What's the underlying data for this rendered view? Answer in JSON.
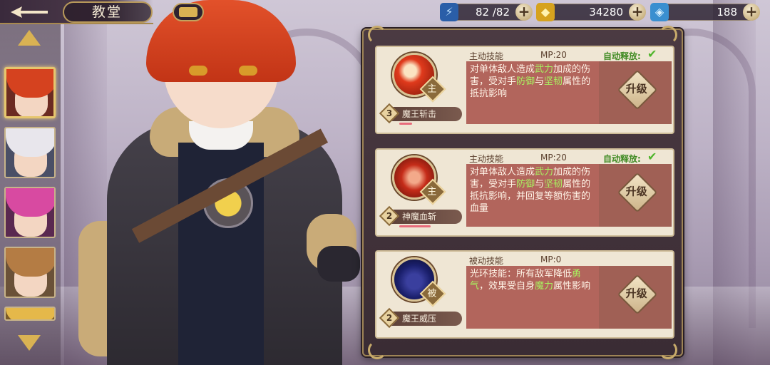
{
  "header": {
    "back_icon": "back-arrow-icon",
    "title": "教堂",
    "scroll_icon": "scroll-icon"
  },
  "resources": {
    "stamina": {
      "icon": "lightning-icon",
      "value": "82 /82"
    },
    "gold": {
      "icon": "gold-coin-icon",
      "value": "34280"
    },
    "gem": {
      "icon": "gem-card-icon",
      "value": "188"
    },
    "plus": "+"
  },
  "heroes": [
    {
      "name": "hero-red-hair",
      "selected": true
    },
    {
      "name": "hero-white-hair",
      "selected": false
    },
    {
      "name": "hero-pink-hair",
      "selected": false
    },
    {
      "name": "hero-brown-hair-glasses",
      "selected": false
    },
    {
      "name": "hero-blonde",
      "selected": false
    }
  ],
  "skills": [
    {
      "type_label": "主动技能",
      "mp_label": "MP:20",
      "auto_label": "自动释放:",
      "auto_check": "✔",
      "badge": "主",
      "level": "3",
      "name": "魔王斩击",
      "progress": 0.2,
      "desc_parts": [
        {
          "text": "对单体敌人造成",
          "hl": false
        },
        {
          "text": "武力",
          "hl": true
        },
        {
          "text": "加成的伤害，受对手",
          "hl": false
        },
        {
          "text": "防御",
          "hl": true
        },
        {
          "text": "与",
          "hl": false
        },
        {
          "text": "坚韧",
          "hl": true
        },
        {
          "text": "属性的抵抗影响",
          "hl": false
        }
      ],
      "upgrade_label": "升级"
    },
    {
      "type_label": "主动技能",
      "mp_label": "MP:20",
      "auto_label": "自动释放:",
      "auto_check": "✔",
      "badge": "主",
      "level": "2",
      "name": "神魔血斩",
      "progress": 0.5,
      "desc_parts": [
        {
          "text": "对单体敌人造成",
          "hl": false
        },
        {
          "text": "武力",
          "hl": true
        },
        {
          "text": "加成的伤害，受对手",
          "hl": false
        },
        {
          "text": "防御",
          "hl": true
        },
        {
          "text": "与",
          "hl": false
        },
        {
          "text": "坚韧",
          "hl": true
        },
        {
          "text": "属性的抵抗影响，并回复等额伤害的血量",
          "hl": false
        }
      ],
      "upgrade_label": "升级"
    },
    {
      "type_label": "被动技能",
      "mp_label": "MP:0",
      "auto_label": "",
      "auto_check": "",
      "badge": "被",
      "level": "2",
      "name": "魔王威压",
      "progress": 0.0,
      "desc_parts": [
        {
          "text": "光环技能：所有敌军降低",
          "hl": false
        },
        {
          "text": "勇气",
          "hl": true
        },
        {
          "text": "，效果受自身",
          "hl": false
        },
        {
          "text": "魔力",
          "hl": true
        },
        {
          "text": "属性影响",
          "hl": false
        }
      ],
      "upgrade_label": "升级"
    }
  ],
  "colors": {
    "accent_gold": "#d9b253",
    "highlight_green": "#a8f060",
    "desc_bg": "#b2655c"
  }
}
